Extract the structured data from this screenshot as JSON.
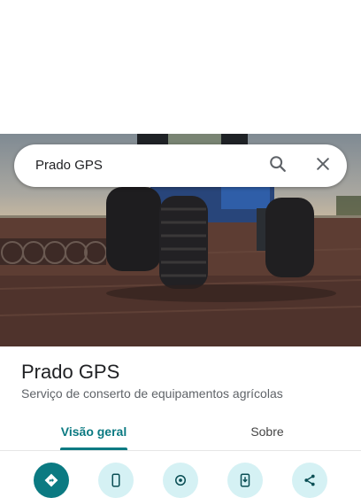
{
  "search": {
    "query": "Prado GPS"
  },
  "place": {
    "name": "Prado GPS",
    "category": "Serviço de conserto de equipamentos agrícolas"
  },
  "tabs": [
    {
      "label": "Visão geral",
      "active": true
    },
    {
      "label": "Sobre",
      "active": false
    }
  ],
  "actions": [
    {
      "icon": "directions-icon",
      "primary": true
    },
    {
      "icon": "phone-icon",
      "primary": false
    },
    {
      "icon": "location-share-icon",
      "primary": false
    },
    {
      "icon": "save-to-phone-icon",
      "primary": false
    },
    {
      "icon": "share-icon",
      "primary": false
    }
  ],
  "colors": {
    "accent": "#0b7a82",
    "action_bg_light": "#d5f1f4",
    "text_primary": "#202124",
    "text_secondary": "#5f6368"
  }
}
